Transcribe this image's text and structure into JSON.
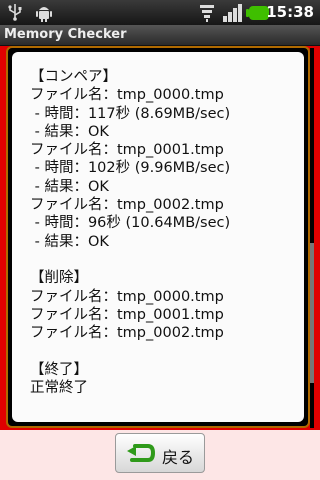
{
  "status_bar": {
    "time": "15:38",
    "icons": [
      "usb-icon",
      "android-icon",
      "wifi-icon",
      "signal-icon",
      "battery-icon"
    ]
  },
  "app": {
    "title": "Memory Checker"
  },
  "log": {
    "lines": [
      "【コンペア】",
      "ファイル名：tmp_0000.tmp",
      " - 時間：117秒 (8.69MB/sec)",
      " - 結果：OK",
      "ファイル名：tmp_0001.tmp",
      " - 時間：102秒 (9.96MB/sec)",
      " - 結果：OK",
      "ファイル名：tmp_0002.tmp",
      " - 時間：96秒 (10.64MB/sec)",
      " - 結果：OK",
      "",
      "【削除】",
      "ファイル名：tmp_0000.tmp",
      "ファイル名：tmp_0001.tmp",
      "ファイル名：tmp_0002.tmp",
      "",
      "【終了】",
      "正常終了"
    ]
  },
  "bottom_bar": {
    "back_label": "戻る"
  },
  "colors": {
    "background": "#e00000",
    "panel_border": "#b06a00",
    "battery": "#3fbf00"
  }
}
